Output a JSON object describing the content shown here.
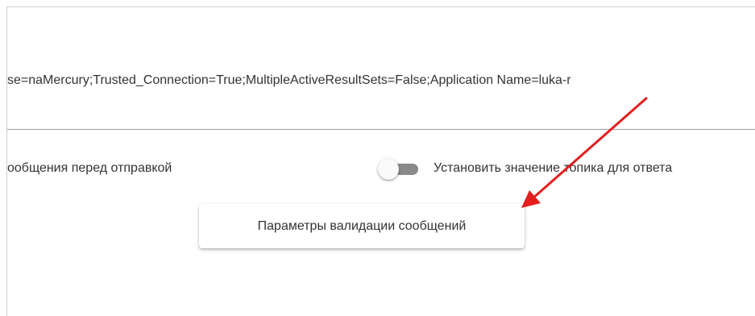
{
  "connection_string": {
    "value": "se=naMercury;Trusted_Connection=True;MultipleActiveResultSets=False;Application Name=luka-r"
  },
  "options": {
    "left_label": "ообщения перед отправкой",
    "topic_toggle_label": "Установить значение топика для ответа"
  },
  "validation_button": {
    "label": "Параметры валидации сообщений"
  },
  "colors": {
    "arrow": "#e31e1e",
    "toggle_track": "#8a8a8a"
  }
}
